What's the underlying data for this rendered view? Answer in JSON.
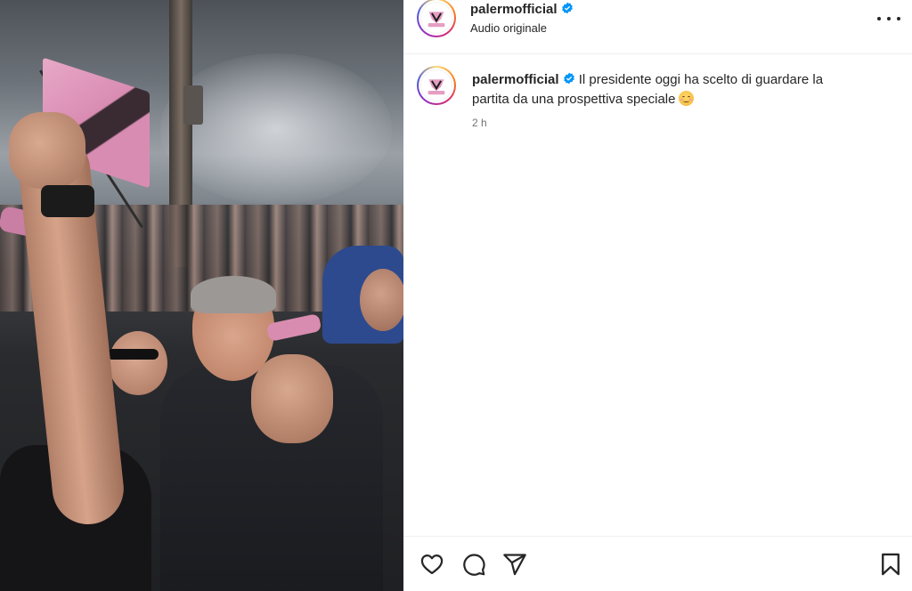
{
  "post": {
    "account": {
      "username": "palermofficial",
      "verified": true,
      "audio_label": "Audio originale",
      "avatar_logo_text": "PALERMO"
    },
    "caption": {
      "username": "palermofficial",
      "text_line1": "Il presidente oggi ha scelto di guardare la",
      "text_line2": "partita da una prospettiva speciale",
      "emoji": "smiling-face-emoji"
    },
    "timestamp": "2 h"
  },
  "icons": {
    "more": "more-options-icon",
    "verified": "verified-badge-icon",
    "like": "heart-icon",
    "comment": "comment-icon",
    "share": "send-icon",
    "save": "bookmark-icon"
  },
  "colors": {
    "verified_blue": "#0095f6",
    "text": "#262626",
    "secondary_text": "#737373",
    "divider": "#efefef",
    "palermo_pink": "#e59ec2"
  }
}
